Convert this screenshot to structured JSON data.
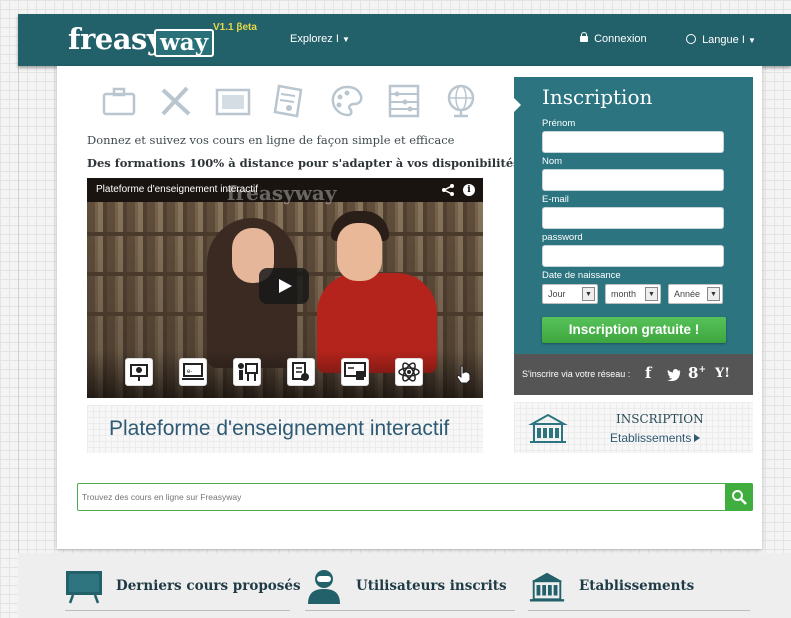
{
  "header": {
    "logo_fr": "freasy",
    "logo_way": "way",
    "version": "V1.1 βeta",
    "explorez": "Explorez",
    "connexion": "Connexion",
    "langue": "Langue"
  },
  "subject_icons": [
    "briefcase-icon",
    "pencil-ruler-icon",
    "book-icon",
    "certificate-icon",
    "palette-icon",
    "abacus-icon",
    "globe-icon"
  ],
  "main": {
    "tagline1": "Donnez et suivez vos cours en ligne de façon simple et efficace",
    "tagline2": "Des formations 100% à distance pour s'adapter à vos disponibilités",
    "video": {
      "title": "Plateforme d'enseignement interactif",
      "watermark": "freasyway",
      "icons": [
        "presentation-icon",
        "e-learning-icon",
        "teacher-icon",
        "document-icon",
        "online-board-icon",
        "atom-icon"
      ]
    },
    "plateforme_title": "Plateforme d'enseignement interactif"
  },
  "inscription": {
    "title": "Inscription",
    "fields": {
      "prenom": "Prénom",
      "nom": "Nom",
      "email": "E-mail",
      "password": "password",
      "naissance": "Date de naissance"
    },
    "selects": {
      "jour": "Jour",
      "month": "month",
      "annee": "Année"
    },
    "button": "Inscription gratuite !",
    "social_label": "S'inscrire via votre réseau :",
    "social_icons": [
      "facebook-icon",
      "twitter-icon",
      "google-plus-icon",
      "yahoo-icon"
    ]
  },
  "etablissements_box": {
    "title": "INSCRIPTION",
    "subtitle": "Etablissements"
  },
  "search": {
    "placeholder": "Trouvez des cours en ligne sur Freasyway"
  },
  "footer": {
    "items": [
      {
        "label": "Derniers cours proposés",
        "icon": "blackboard-icon"
      },
      {
        "label": "Utilisateurs inscrits",
        "icon": "user-icon"
      },
      {
        "label": "Etablissements",
        "icon": "building-icon"
      }
    ]
  },
  "colors": {
    "teal": "#23616a",
    "inscription_bg": "#2b7480",
    "green": "#3fae3f",
    "link_blue": "#2e5a74"
  }
}
